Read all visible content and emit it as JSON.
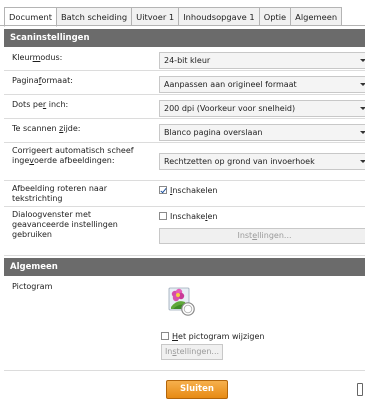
{
  "tabs": [
    {
      "label": "Document",
      "active": true
    },
    {
      "label": "Batch scheiding",
      "active": false
    },
    {
      "label": "Uitvoer 1",
      "active": false
    },
    {
      "label": "Inhoudsopgave 1",
      "active": false
    },
    {
      "label": "Optie",
      "active": false
    },
    {
      "label": "Algemeen",
      "active": false
    }
  ],
  "scan_section": {
    "title": "Scaninstellingen",
    "color_mode": {
      "label_pre": "Kleur",
      "label_key": "m",
      "label_post": "odus:",
      "value": "24-bit kleur"
    },
    "page_format": {
      "label_pre": "Pagina",
      "label_key": "f",
      "label_post": "ormaat:",
      "value": "Aanpassen aan origineel formaat"
    },
    "dpi": {
      "label_pre": "Dots pe",
      "label_key": "r",
      "label_post": " inch:",
      "value": "200 dpi (Voorkeur voor snelheid)"
    },
    "side": {
      "label_pre": "Te scannen ",
      "label_key": "z",
      "label_post": "ijde:",
      "value": "Blanco pagina overslaan"
    },
    "deskew": {
      "label_pre": "Corrigeert automatisch scheef inge",
      "label_key": "v",
      "label_post": "oerde afbeeldingen:",
      "value": "Rechtzetten op grond van invoerhoek"
    },
    "rotate": {
      "label": "Afbeelding roteren naar tekstrichting",
      "check_key": "I",
      "check_post": "nschakelen",
      "checked": true
    },
    "advanced": {
      "label": "Dialoogvenster met geavanceerde instellingen gebruiken",
      "check_pre": "Inschake",
      "check_key": "l",
      "check_post": "en",
      "checked": false,
      "button_pre": "Inst",
      "button_key": "e",
      "button_post": "llingen..."
    }
  },
  "general_section": {
    "title": "Algemeen",
    "pictogram": {
      "label": "Pictogram",
      "icon": "flower-icon",
      "check_key": "H",
      "check_post": "et pictogram wijzigen",
      "checked": false,
      "button_pre": "In",
      "button_key": "s",
      "button_post": "tellingen..."
    }
  },
  "footer": {
    "close_label": "Sluiten"
  }
}
